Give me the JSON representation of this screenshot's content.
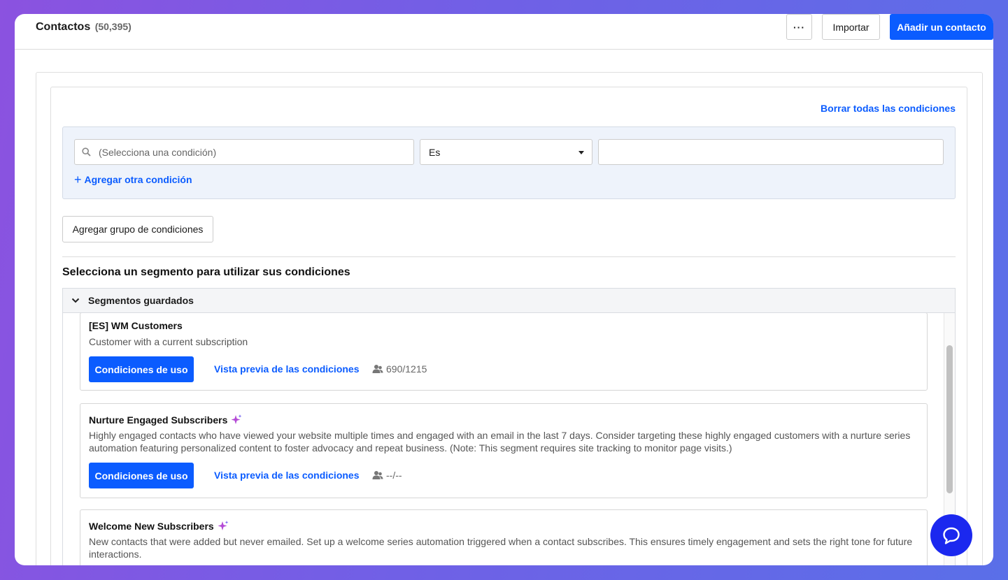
{
  "header": {
    "title": "Contactos",
    "count": "(50,395)",
    "more_label": "···",
    "import_label": "Importar",
    "add_contact_label": "Añadir un contacto"
  },
  "conditions": {
    "clear_all_label": "Borrar todas las condiciones",
    "search_placeholder": "(Selecciona una condición)",
    "operator_value": "Es",
    "value": "",
    "add_condition_label": "Agregar otra condición",
    "add_group_label": "Agregar grupo de condiciones"
  },
  "segments": {
    "section_title": "Selecciona un segmento para utilizar sus condiciones",
    "saved_header": "Segmentos guardados",
    "items": [
      {
        "title": "[ES] WM Customers",
        "description": "Customer with a current subscription",
        "use_label": "Condiciones de uso",
        "preview_label": "Vista previa de las condiciones",
        "stat": "690/1215"
      },
      {
        "title": "Nurture Engaged Subscribers",
        "description": "Highly engaged contacts who have viewed your website multiple times and engaged with an email in the last 7 days. Consider targeting these highly engaged customers with a nurture series automation featuring personalized content to foster advocacy and repeat business. (Note: This segment requires site tracking to monitor page visits.)",
        "use_label": "Condiciones de uso",
        "preview_label": "Vista previa de las condiciones",
        "stat": "--/--"
      },
      {
        "title": "Welcome New Subscribers",
        "description": "New contacts that were added but never emailed. Set up a welcome series automation triggered when a contact subscribes. This ensures timely engagement and sets the right tone for future interactions."
      }
    ]
  },
  "colors": {
    "accent": "#0b5cff",
    "chat": "#1b28ef"
  },
  "icons": [
    "search-icon",
    "caret-down-icon",
    "plus-icon",
    "chevron-down-icon",
    "sparkle-icon",
    "people-icon",
    "chat-icon"
  ]
}
